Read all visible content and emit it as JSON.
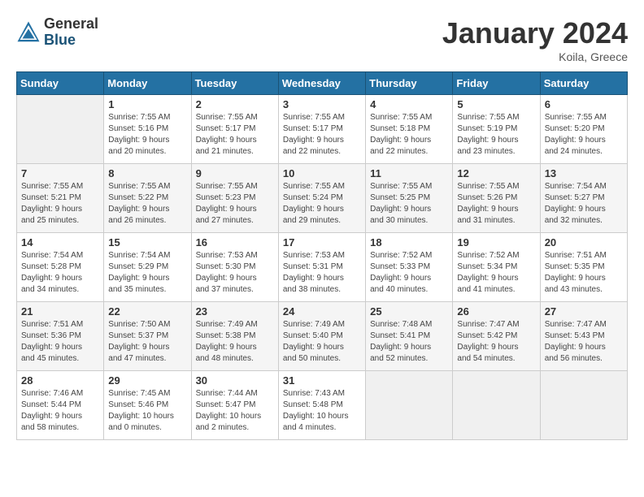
{
  "header": {
    "logo_general": "General",
    "logo_blue": "Blue",
    "month_title": "January 2024",
    "location": "Koila, Greece"
  },
  "columns": [
    "Sunday",
    "Monday",
    "Tuesday",
    "Wednesday",
    "Thursday",
    "Friday",
    "Saturday"
  ],
  "weeks": [
    [
      {
        "day": "",
        "info": ""
      },
      {
        "day": "1",
        "info": "Sunrise: 7:55 AM\nSunset: 5:16 PM\nDaylight: 9 hours\nand 20 minutes."
      },
      {
        "day": "2",
        "info": "Sunrise: 7:55 AM\nSunset: 5:17 PM\nDaylight: 9 hours\nand 21 minutes."
      },
      {
        "day": "3",
        "info": "Sunrise: 7:55 AM\nSunset: 5:17 PM\nDaylight: 9 hours\nand 22 minutes."
      },
      {
        "day": "4",
        "info": "Sunrise: 7:55 AM\nSunset: 5:18 PM\nDaylight: 9 hours\nand 22 minutes."
      },
      {
        "day": "5",
        "info": "Sunrise: 7:55 AM\nSunset: 5:19 PM\nDaylight: 9 hours\nand 23 minutes."
      },
      {
        "day": "6",
        "info": "Sunrise: 7:55 AM\nSunset: 5:20 PM\nDaylight: 9 hours\nand 24 minutes."
      }
    ],
    [
      {
        "day": "7",
        "info": "Sunrise: 7:55 AM\nSunset: 5:21 PM\nDaylight: 9 hours\nand 25 minutes."
      },
      {
        "day": "8",
        "info": "Sunrise: 7:55 AM\nSunset: 5:22 PM\nDaylight: 9 hours\nand 26 minutes."
      },
      {
        "day": "9",
        "info": "Sunrise: 7:55 AM\nSunset: 5:23 PM\nDaylight: 9 hours\nand 27 minutes."
      },
      {
        "day": "10",
        "info": "Sunrise: 7:55 AM\nSunset: 5:24 PM\nDaylight: 9 hours\nand 29 minutes."
      },
      {
        "day": "11",
        "info": "Sunrise: 7:55 AM\nSunset: 5:25 PM\nDaylight: 9 hours\nand 30 minutes."
      },
      {
        "day": "12",
        "info": "Sunrise: 7:55 AM\nSunset: 5:26 PM\nDaylight: 9 hours\nand 31 minutes."
      },
      {
        "day": "13",
        "info": "Sunrise: 7:54 AM\nSunset: 5:27 PM\nDaylight: 9 hours\nand 32 minutes."
      }
    ],
    [
      {
        "day": "14",
        "info": "Sunrise: 7:54 AM\nSunset: 5:28 PM\nDaylight: 9 hours\nand 34 minutes."
      },
      {
        "day": "15",
        "info": "Sunrise: 7:54 AM\nSunset: 5:29 PM\nDaylight: 9 hours\nand 35 minutes."
      },
      {
        "day": "16",
        "info": "Sunrise: 7:53 AM\nSunset: 5:30 PM\nDaylight: 9 hours\nand 37 minutes."
      },
      {
        "day": "17",
        "info": "Sunrise: 7:53 AM\nSunset: 5:31 PM\nDaylight: 9 hours\nand 38 minutes."
      },
      {
        "day": "18",
        "info": "Sunrise: 7:52 AM\nSunset: 5:33 PM\nDaylight: 9 hours\nand 40 minutes."
      },
      {
        "day": "19",
        "info": "Sunrise: 7:52 AM\nSunset: 5:34 PM\nDaylight: 9 hours\nand 41 minutes."
      },
      {
        "day": "20",
        "info": "Sunrise: 7:51 AM\nSunset: 5:35 PM\nDaylight: 9 hours\nand 43 minutes."
      }
    ],
    [
      {
        "day": "21",
        "info": "Sunrise: 7:51 AM\nSunset: 5:36 PM\nDaylight: 9 hours\nand 45 minutes."
      },
      {
        "day": "22",
        "info": "Sunrise: 7:50 AM\nSunset: 5:37 PM\nDaylight: 9 hours\nand 47 minutes."
      },
      {
        "day": "23",
        "info": "Sunrise: 7:49 AM\nSunset: 5:38 PM\nDaylight: 9 hours\nand 48 minutes."
      },
      {
        "day": "24",
        "info": "Sunrise: 7:49 AM\nSunset: 5:40 PM\nDaylight: 9 hours\nand 50 minutes."
      },
      {
        "day": "25",
        "info": "Sunrise: 7:48 AM\nSunset: 5:41 PM\nDaylight: 9 hours\nand 52 minutes."
      },
      {
        "day": "26",
        "info": "Sunrise: 7:47 AM\nSunset: 5:42 PM\nDaylight: 9 hours\nand 54 minutes."
      },
      {
        "day": "27",
        "info": "Sunrise: 7:47 AM\nSunset: 5:43 PM\nDaylight: 9 hours\nand 56 minutes."
      }
    ],
    [
      {
        "day": "28",
        "info": "Sunrise: 7:46 AM\nSunset: 5:44 PM\nDaylight: 9 hours\nand 58 minutes."
      },
      {
        "day": "29",
        "info": "Sunrise: 7:45 AM\nSunset: 5:46 PM\nDaylight: 10 hours\nand 0 minutes."
      },
      {
        "day": "30",
        "info": "Sunrise: 7:44 AM\nSunset: 5:47 PM\nDaylight: 10 hours\nand 2 minutes."
      },
      {
        "day": "31",
        "info": "Sunrise: 7:43 AM\nSunset: 5:48 PM\nDaylight: 10 hours\nand 4 minutes."
      },
      {
        "day": "",
        "info": ""
      },
      {
        "day": "",
        "info": ""
      },
      {
        "day": "",
        "info": ""
      }
    ]
  ]
}
